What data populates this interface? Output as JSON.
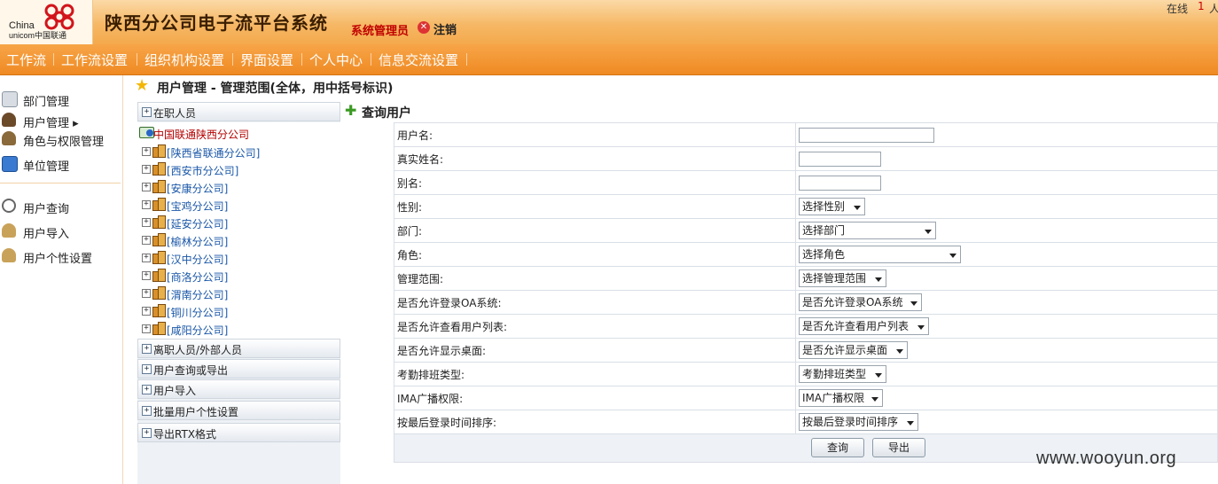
{
  "header": {
    "logo_line1": "China",
    "logo_line2": "unicom中国联通",
    "app_title": "陕西分公司电子流平台系统",
    "user_role": "系统管理员",
    "logout": "注销",
    "online_label": "在线",
    "online_count": "1",
    "online_trail": "人"
  },
  "nav": [
    "工作流",
    "工作流设置",
    "组织机构设置",
    "界面设置",
    "个人中心",
    "信息交流设置"
  ],
  "sidebar": {
    "items": [
      {
        "label": "部门管理",
        "icon": "department-icon"
      },
      {
        "label": "用户管理 ▸",
        "icon": "user-icon"
      },
      {
        "label": "角色与权限管理",
        "icon": "role-icon"
      },
      {
        "label": "单位管理",
        "icon": "home-icon"
      },
      {
        "label": "用户查询",
        "icon": "magnifier-icon"
      },
      {
        "label": "用户导入",
        "icon": "users-import-icon"
      },
      {
        "label": "用户个性设置",
        "icon": "users-settings-icon"
      }
    ]
  },
  "page": {
    "title": "用户管理  - 管理范围(全体，用中括号标识)"
  },
  "tree_panel": {
    "top_section": "在职人员",
    "root": "中国联通陕西分公司",
    "nodes": [
      "[陕西省联通分公司]",
      "[西安市分公司]",
      "[安康分公司]",
      "[宝鸡分公司]",
      "[延安分公司]",
      "[榆林分公司]",
      "[汉中分公司]",
      "[商洛分公司]",
      "[渭南分公司]",
      "[铜川分公司]",
      "[咸阳分公司]"
    ],
    "sections": [
      "离职人员/外部人员",
      "用户查询或导出",
      "用户导入",
      "批量用户个性设置",
      "导出RTX格式"
    ]
  },
  "query": {
    "title": "查询用户",
    "fields": [
      {
        "label": "用户名:",
        "type": "text",
        "value": ""
      },
      {
        "label": "真实姓名:",
        "type": "text",
        "value": ""
      },
      {
        "label": "别名:",
        "type": "text",
        "value": ""
      },
      {
        "label": "性别:",
        "type": "select",
        "value": "选择性别"
      },
      {
        "label": "部门:",
        "type": "select",
        "value": "选择部门"
      },
      {
        "label": "角色:",
        "type": "select",
        "value": "选择角色"
      },
      {
        "label": "管理范围:",
        "type": "select",
        "value": "选择管理范围"
      },
      {
        "label": "是否允许登录OA系统:",
        "type": "select",
        "value": "是否允许登录OA系统"
      },
      {
        "label": "是否允许查看用户列表:",
        "type": "select",
        "value": "是否允许查看用户列表"
      },
      {
        "label": "是否允许显示桌面:",
        "type": "select",
        "value": "是否允许显示桌面"
      },
      {
        "label": "考勤排班类型:",
        "type": "select",
        "value": "考勤排班类型"
      },
      {
        "label": "IMA广播权限:",
        "type": "select",
        "value": "IMA广播权限"
      },
      {
        "label": "按最后登录时间排序:",
        "type": "select",
        "value": "按最后登录时间排序"
      }
    ],
    "buttons": {
      "search": "查询",
      "export": "导出"
    }
  },
  "watermark": "www.wooyun.org",
  "colors": {
    "nav_orange": "#ef8a23",
    "header_orange": "#f6b866",
    "tree_link": "#1a57a8",
    "root_red": "#b40000"
  }
}
